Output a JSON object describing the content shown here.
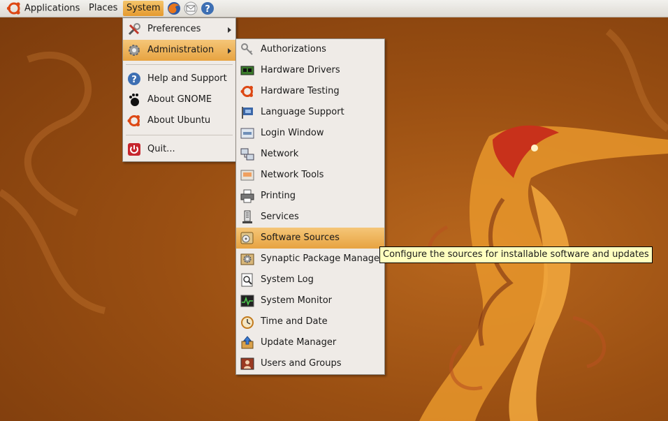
{
  "panel": {
    "applications": "Applications",
    "places": "Places",
    "system": "System",
    "launchers": [
      "firefox-icon",
      "mail-icon",
      "help-icon"
    ]
  },
  "system_menu": {
    "items": [
      {
        "label": "Preferences",
        "icon": "preferences-icon",
        "submenu": true
      },
      {
        "label": "Administration",
        "icon": "administration-gear-icon",
        "submenu": true,
        "selected": true
      },
      {
        "label": "Help and Support",
        "icon": "help-icon"
      },
      {
        "label": "About GNOME",
        "icon": "gnome-foot-icon"
      },
      {
        "label": "About Ubuntu",
        "icon": "ubuntu-logo-icon"
      },
      {
        "label": "Quit...",
        "icon": "quit-icon"
      }
    ]
  },
  "admin_menu": {
    "items": [
      {
        "label": "Authorizations",
        "icon": "keys-icon"
      },
      {
        "label": "Hardware Drivers",
        "icon": "hardware-card-icon"
      },
      {
        "label": "Hardware Testing",
        "icon": "ubuntu-logo-icon"
      },
      {
        "label": "Language Support",
        "icon": "language-flag-icon"
      },
      {
        "label": "Login Window",
        "icon": "login-window-icon"
      },
      {
        "label": "Network",
        "icon": "network-icon"
      },
      {
        "label": "Network Tools",
        "icon": "network-tools-icon"
      },
      {
        "label": "Printing",
        "icon": "printer-icon"
      },
      {
        "label": "Services",
        "icon": "services-icon"
      },
      {
        "label": "Software Sources",
        "icon": "software-sources-icon",
        "selected": true
      },
      {
        "label": "Synaptic Package Manager",
        "icon": "synaptic-icon"
      },
      {
        "label": "System Log",
        "icon": "system-log-icon"
      },
      {
        "label": "System Monitor",
        "icon": "system-monitor-icon"
      },
      {
        "label": "Time and Date",
        "icon": "clock-icon"
      },
      {
        "label": "Update Manager",
        "icon": "update-manager-icon"
      },
      {
        "label": "Users and Groups",
        "icon": "users-groups-icon"
      }
    ]
  },
  "tooltip": "Configure the sources for installable software and updates",
  "colors": {
    "desktop": "#9a4f12",
    "highlight": "#e7a341",
    "menu_bg": "#efebe7",
    "tooltip_bg": "#ffffbf"
  }
}
